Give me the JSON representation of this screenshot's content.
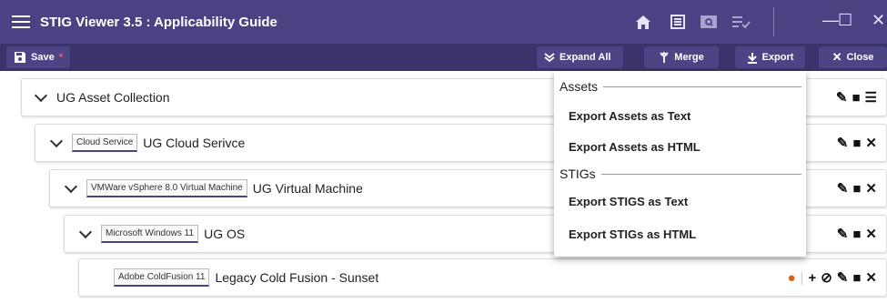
{
  "window": {
    "title": "STIG Viewer 3.5 : Applicability Guide",
    "controls": {
      "minimize": "—",
      "maximize": "☐",
      "close": "✕"
    }
  },
  "titlebar_icons": [
    "home-icon",
    "document-list-icon",
    "search-card-icon",
    "checklist-icon"
  ],
  "toolbar": {
    "save_label": "Save",
    "save_modified": "*",
    "expand_all_label": "Expand All",
    "merge_label": "Merge",
    "export_label": "Export",
    "close_label": "Close"
  },
  "tree": {
    "rows": [
      {
        "badge": "",
        "label": "UG Asset Collection"
      },
      {
        "badge": "Cloud Service",
        "label": "UG Cloud Serivce"
      },
      {
        "badge": "VMWare vSphere 8.0 Virtual Machine",
        "label": "UG Virtual Machine"
      },
      {
        "badge": "Microsoft Windows 11",
        "label": "UG OS"
      },
      {
        "badge": "Adobe ColdFusion 11",
        "label": "Legacy Cold Fusion - Sunset"
      }
    ]
  },
  "export_menu": {
    "assets_header": "Assets",
    "assets_text": "Export Assets as Text",
    "assets_html": "Export Assets as HTML",
    "stigs_header": "STIGs",
    "stigs_text": "Export STIGS as Text",
    "stigs_html": "Export STIGs as HTML"
  },
  "colors": {
    "titlebar": "#4a4283",
    "toolbar": "#3a346a",
    "accent_warning": "#e8590c"
  }
}
